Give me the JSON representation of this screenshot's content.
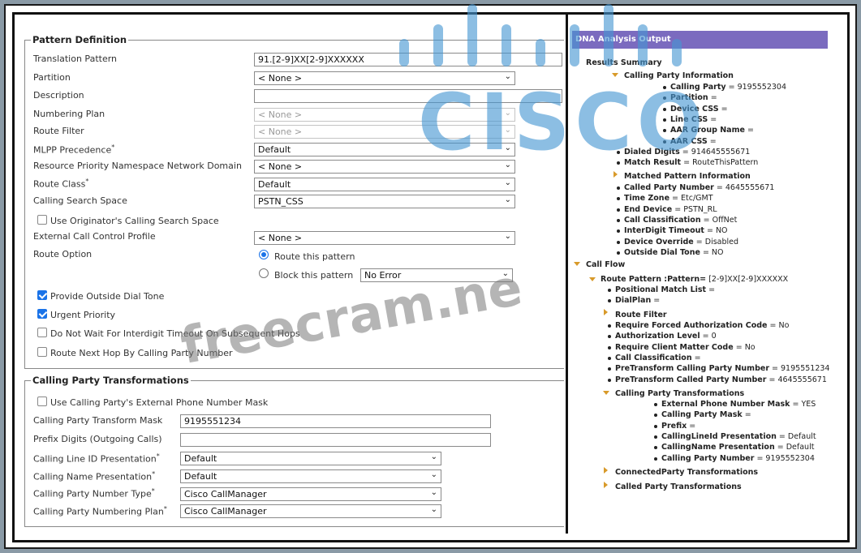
{
  "pattern_definition": {
    "legend": "Pattern Definition",
    "fields": {
      "translation_pattern": {
        "label": "Translation Pattern",
        "value": "91.[2-9]XX[2-9]XXXXXX"
      },
      "partition": {
        "label": "Partition",
        "value": "< None >"
      },
      "description": {
        "label": "Description",
        "value": ""
      },
      "numbering_plan": {
        "label": "Numbering Plan",
        "value": "< None >"
      },
      "route_filter": {
        "label": "Route Filter",
        "value": "< None >"
      },
      "mlpp_precedence": {
        "label": "MLPP Precedence",
        "value": "Default"
      },
      "resource_priority": {
        "label": "Resource Priority Namespace Network Domain",
        "value": "< None >"
      },
      "route_class": {
        "label": "Route Class",
        "value": "Default"
      },
      "calling_search_space": {
        "label": "Calling Search Space",
        "value": "PSTN_CSS"
      },
      "use_originator_css": {
        "label": "Use Originator's Calling Search Space"
      },
      "external_call_control": {
        "label": "External Call Control Profile",
        "value": "< None >"
      },
      "route_option": {
        "label": "Route Option",
        "route_this": "Route this pattern",
        "block_this": "Block this pattern",
        "block_value": "No Error"
      }
    },
    "checkboxes": {
      "provide_outside_dial_tone": "Provide Outside Dial Tone",
      "urgent_priority": "Urgent Priority",
      "do_not_wait": "Do Not Wait For Interdigit Timeout On Subsequent Hops",
      "route_next_hop": "Route Next Hop By Calling Party Number"
    }
  },
  "calling_party_transformations": {
    "legend": "Calling Party Transformations",
    "use_external_mask": "Use Calling Party's External Phone Number Mask",
    "transform_mask": {
      "label": "Calling Party Transform Mask",
      "value": "9195551234"
    },
    "prefix_digits": {
      "label": "Prefix Digits (Outgoing Calls)",
      "value": ""
    },
    "calling_line_id": {
      "label": "Calling Line ID Presentation",
      "value": "Default"
    },
    "calling_name": {
      "label": "Calling Name Presentation",
      "value": "Default"
    },
    "party_number_type": {
      "label": "Calling Party Number Type",
      "value": "Cisco CallManager"
    },
    "numbering_plan": {
      "label": "Calling Party Numbering Plan",
      "value": "Cisco CallManager"
    }
  },
  "dna": {
    "header": "DNA Analysis Output",
    "results_summary": "Results Summary",
    "calling_party_info": "Calling Party Information",
    "cp_items": [
      {
        "k": "Calling Party",
        "v": "= 9195552304"
      },
      {
        "k": "Partition",
        "v": "="
      },
      {
        "k": "Device CSS",
        "v": "="
      },
      {
        "k": "Line CSS",
        "v": "="
      },
      {
        "k": "AAR Group Name",
        "v": "="
      },
      {
        "k": "AAR CSS",
        "v": "="
      }
    ],
    "dialed_digits": {
      "k": "Dialed Digits",
      "v": "= 914645555671"
    },
    "match_result": {
      "k": "Match Result",
      "v": "= RouteThisPattern"
    },
    "matched_pattern_info": "Matched Pattern Information",
    "mp_items": [
      {
        "k": "Called Party Number",
        "v": "= 4645555671"
      },
      {
        "k": "Time Zone",
        "v": "= Etc/GMT"
      },
      {
        "k": "End Device",
        "v": "= PSTN_RL"
      },
      {
        "k": "Call Classification",
        "v": "= OffNet"
      },
      {
        "k": "InterDigit Timeout",
        "v": "= NO"
      },
      {
        "k": "Device Override",
        "v": "= Disabled"
      },
      {
        "k": "Outside Dial Tone",
        "v": "= NO"
      }
    ],
    "call_flow": "Call Flow",
    "route_pattern": {
      "k": "Route Pattern :Pattern=",
      "v": "[2-9]XX[2-9]XXXXXX"
    },
    "rp_items": [
      {
        "k": "Positional Match List",
        "v": "="
      },
      {
        "k": "DialPlan",
        "v": "="
      }
    ],
    "route_filter": "Route Filter",
    "rf_items": [
      {
        "k": "Require Forced Authorization Code",
        "v": "= No"
      },
      {
        "k": "Authorization Level",
        "v": "= 0"
      },
      {
        "k": "Require Client Matter Code",
        "v": "= No"
      },
      {
        "k": "Call Classification",
        "v": "="
      },
      {
        "k": "PreTransform Calling Party Number",
        "v": "= 9195551234"
      },
      {
        "k": "PreTransform Called Party Number",
        "v": "= 4645555671"
      }
    ],
    "cpt": "Calling Party Transformations",
    "cpt_items": [
      {
        "k": "External Phone Number Mask",
        "v": "= YES"
      },
      {
        "k": "Calling Party Mask",
        "v": "="
      },
      {
        "k": "Prefix",
        "v": "="
      },
      {
        "k": "CallingLineId Presentation",
        "v": "= Default"
      },
      {
        "k": "CallingName Presentation",
        "v": "= Default"
      },
      {
        "k": "Calling Party Number",
        "v": "= 9195552304"
      }
    ],
    "connected_party": "ConnectedParty Transformations",
    "called_party": "Called Party Transformations"
  },
  "watermark": {
    "brand": "CISCO",
    "site": "freecram.ne"
  }
}
